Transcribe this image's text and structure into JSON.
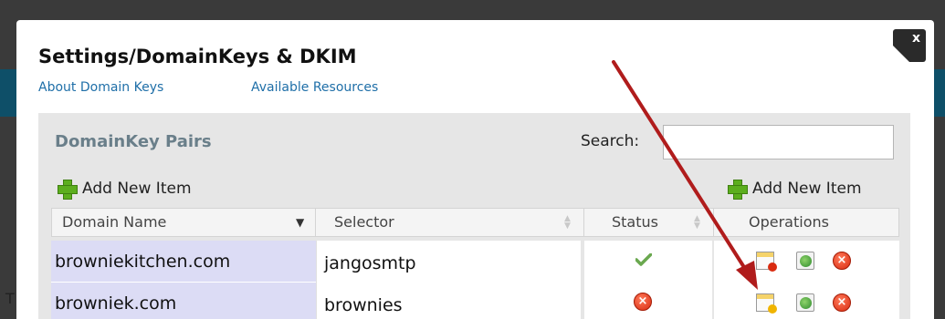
{
  "dialog": {
    "title": "Settings/DomainKeys & DKIM",
    "links": [
      "About Domain Keys",
      "Available Resources"
    ],
    "close_label": "x"
  },
  "panel": {
    "title": "DomainKey Pairs",
    "search_label": "Search:",
    "search_value": "",
    "add_item_label": "Add New Item"
  },
  "table": {
    "columns": [
      "Domain Name",
      "Selector",
      "Status",
      "Operations"
    ],
    "rows": [
      {
        "domain": "browniekitchen.com",
        "selector": "jangosmtp",
        "status": "check-icon",
        "operations": [
          "edit-doc-icon",
          "globe-icon",
          "delete-icon"
        ]
      },
      {
        "domain": "browniek.com",
        "selector": "brownies",
        "status": "x-icon",
        "operations": [
          "edit-doc-icon",
          "globe-icon",
          "delete-icon"
        ]
      }
    ]
  },
  "colors": {
    "link": "#1f6fa8",
    "row_highlight": "#dcdcf5",
    "arrow": "#b01c1c",
    "success": "#6aa84f",
    "danger": "#d92b10"
  },
  "background": {
    "stray_text": "T"
  }
}
